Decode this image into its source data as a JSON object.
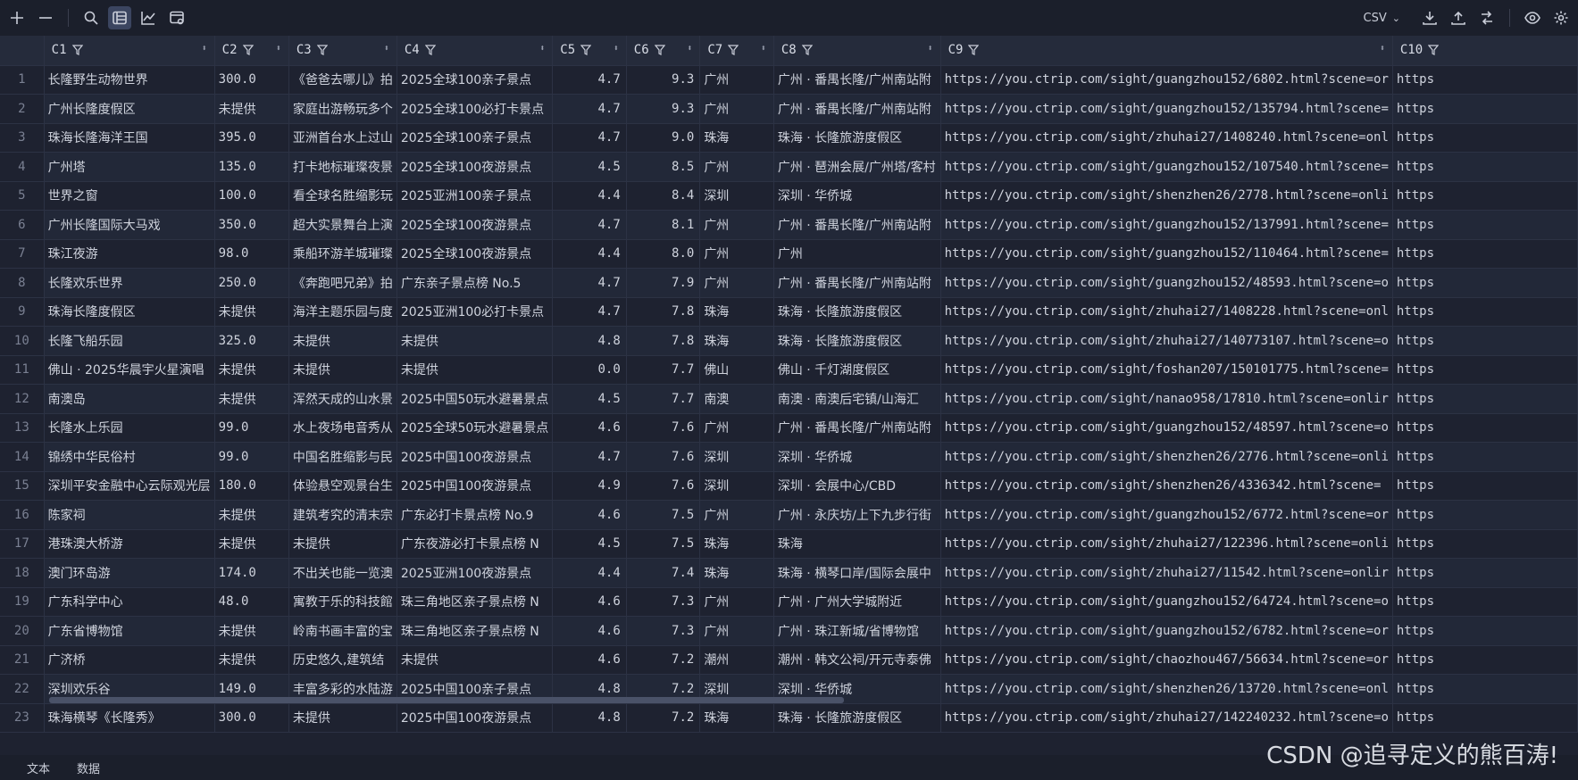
{
  "toolbar": {
    "format": "CSV"
  },
  "columns": [
    "C1",
    "C2",
    "C3",
    "C4",
    "C5",
    "C6",
    "C7",
    "C8",
    "C9",
    "C10"
  ],
  "rows": [
    [
      "1",
      "长隆野生动物世界",
      "300.0",
      "《爸爸去哪儿》拍",
      "2025全球100亲子景点",
      "4.7",
      "9.3",
      "广州",
      "广州 · 番禺长隆/广州南站附",
      "https://you.ctrip.com/sight/guangzhou152/6802.html?scene=or",
      "https"
    ],
    [
      "2",
      "广州长隆度假区",
      "未提供",
      "家庭出游畅玩多个",
      "2025全球100必打卡景点",
      "4.7",
      "9.3",
      "广州",
      "广州 · 番禺长隆/广州南站附",
      "https://you.ctrip.com/sight/guangzhou152/135794.html?scene=",
      "https"
    ],
    [
      "3",
      "珠海长隆海洋王国",
      "395.0",
      "亚洲首台水上过山",
      "2025全球100亲子景点",
      "4.7",
      "9.0",
      "珠海",
      "珠海 · 长隆旅游度假区",
      "https://you.ctrip.com/sight/zhuhai27/1408240.html?scene=onl",
      "https"
    ],
    [
      "4",
      "广州塔",
      "135.0",
      "打卡地标璀璨夜景",
      "2025全球100夜游景点",
      "4.5",
      "8.5",
      "广州",
      "广州 · 琶洲会展/广州塔/客村",
      "https://you.ctrip.com/sight/guangzhou152/107540.html?scene=",
      "https"
    ],
    [
      "5",
      "世界之窗",
      "100.0",
      "看全球名胜缩影玩",
      "2025亚洲100亲子景点",
      "4.4",
      "8.4",
      "深圳",
      "深圳 · 华侨城",
      "https://you.ctrip.com/sight/shenzhen26/2778.html?scene=onli",
      "https"
    ],
    [
      "6",
      "广州长隆国际大马戏",
      "350.0",
      "超大实景舞台上演",
      "2025全球100夜游景点",
      "4.7",
      "8.1",
      "广州",
      "广州 · 番禺长隆/广州南站附",
      "https://you.ctrip.com/sight/guangzhou152/137991.html?scene=",
      "https"
    ],
    [
      "7",
      "珠江夜游",
      "98.0",
      "乘船环游羊城璀璨",
      "2025全球100夜游景点",
      "4.4",
      "8.0",
      "广州",
      "广州",
      "https://you.ctrip.com/sight/guangzhou152/110464.html?scene=",
      "https"
    ],
    [
      "8",
      "长隆欢乐世界",
      "250.0",
      "《奔跑吧兄弟》拍",
      "广东亲子景点榜 No.5",
      "4.7",
      "7.9",
      "广州",
      "广州 · 番禺长隆/广州南站附",
      "https://you.ctrip.com/sight/guangzhou152/48593.html?scene=o",
      "https"
    ],
    [
      "9",
      "珠海长隆度假区",
      "未提供",
      "海洋主题乐园与度",
      "2025亚洲100必打卡景点",
      "4.7",
      "7.8",
      "珠海",
      "珠海 · 长隆旅游度假区",
      "https://you.ctrip.com/sight/zhuhai27/1408228.html?scene=onl",
      "https"
    ],
    [
      "10",
      "长隆飞船乐园",
      "325.0",
      "未提供",
      "未提供",
      "4.8",
      "7.8",
      "珠海",
      "珠海 · 长隆旅游度假区",
      "https://you.ctrip.com/sight/zhuhai27/140773107.html?scene=o",
      "https"
    ],
    [
      "11",
      "佛山 · 2025华晨宇火星演唱",
      "未提供",
      "未提供",
      "未提供",
      "0.0",
      "7.7",
      "佛山",
      "佛山 · 千灯湖度假区",
      "https://you.ctrip.com/sight/foshan207/150101775.html?scene=",
      "https"
    ],
    [
      "12",
      "南澳岛",
      "未提供",
      "浑然天成的山水景",
      "2025中国50玩水避暑景点",
      "4.5",
      "7.7",
      "南澳",
      "南澳 · 南澳后宅镇/山海汇",
      "https://you.ctrip.com/sight/nanao958/17810.html?scene=onlir",
      "https"
    ],
    [
      "13",
      "长隆水上乐园",
      "99.0",
      "水上夜场电音秀从",
      "2025全球50玩水避暑景点",
      "4.6",
      "7.6",
      "广州",
      "广州 · 番禺长隆/广州南站附",
      "https://you.ctrip.com/sight/guangzhou152/48597.html?scene=o",
      "https"
    ],
    [
      "14",
      "锦绣中华民俗村",
      "99.0",
      "中国名胜缩影与民",
      "2025中国100夜游景点",
      "4.7",
      "7.6",
      "深圳",
      "深圳 · 华侨城",
      "https://you.ctrip.com/sight/shenzhen26/2776.html?scene=onli",
      "https"
    ],
    [
      "15",
      "深圳平安金融中心云际观光层",
      "180.0",
      "体验悬空观景台生",
      "2025中国100夜游景点",
      "4.9",
      "7.6",
      "深圳",
      "深圳 · 会展中心/CBD",
      "https://you.ctrip.com/sight/shenzhen26/4336342.html?scene=",
      "https"
    ],
    [
      "16",
      "陈家祠",
      "未提供",
      "建筑考究的清末宗",
      "广东必打卡景点榜 No.9",
      "4.6",
      "7.5",
      "广州",
      "广州 · 永庆坊/上下九步行街",
      "https://you.ctrip.com/sight/guangzhou152/6772.html?scene=or",
      "https"
    ],
    [
      "17",
      "港珠澳大桥游",
      "未提供",
      "未提供",
      "广东夜游必打卡景点榜 N",
      "4.5",
      "7.5",
      "珠海",
      "珠海",
      "https://you.ctrip.com/sight/zhuhai27/122396.html?scene=onli",
      "https"
    ],
    [
      "18",
      "澳门环岛游",
      "174.0",
      "不出关也能一览澳",
      "2025亚洲100夜游景点",
      "4.4",
      "7.4",
      "珠海",
      "珠海 · 横琴口岸/国际会展中",
      "https://you.ctrip.com/sight/zhuhai27/11542.html?scene=onlir",
      "https"
    ],
    [
      "19",
      "广东科学中心",
      "48.0",
      "寓教于乐的科技館",
      "珠三角地区亲子景点榜 N",
      "4.6",
      "7.3",
      "广州",
      "广州 · 广州大学城附近",
      "https://you.ctrip.com/sight/guangzhou152/64724.html?scene=o",
      "https"
    ],
    [
      "20",
      "广东省博物馆",
      "未提供",
      "岭南书画丰富的宝",
      "珠三角地区亲子景点榜 N",
      "4.6",
      "7.3",
      "广州",
      "广州 · 珠江新城/省博物馆",
      "https://you.ctrip.com/sight/guangzhou152/6782.html?scene=or",
      "https"
    ],
    [
      "21",
      "广济桥",
      "未提供",
      "历史悠久,建筑结",
      "未提供",
      "4.6",
      "7.2",
      "潮州",
      "潮州 · 韩文公祠/开元寺泰佛",
      "https://you.ctrip.com/sight/chaozhou467/56634.html?scene=or",
      "https"
    ],
    [
      "22",
      "深圳欢乐谷",
      "149.0",
      "丰富多彩的水陆游",
      "2025中国100亲子景点",
      "4.8",
      "7.2",
      "深圳",
      "深圳 · 华侨城",
      "https://you.ctrip.com/sight/shenzhen26/13720.html?scene=onl",
      "https"
    ],
    [
      "23",
      "珠海横琴《长隆秀》",
      "300.0",
      "未提供",
      "2025中国100夜游景点",
      "4.8",
      "7.2",
      "珠海",
      "珠海 · 长隆旅游度假区",
      "https://you.ctrip.com/sight/zhuhai27/142240232.html?scene=o",
      "https"
    ]
  ],
  "bottom_tabs": [
    "文本",
    "数据"
  ],
  "watermark": "CSDN @追寻定义的熊百涛!"
}
